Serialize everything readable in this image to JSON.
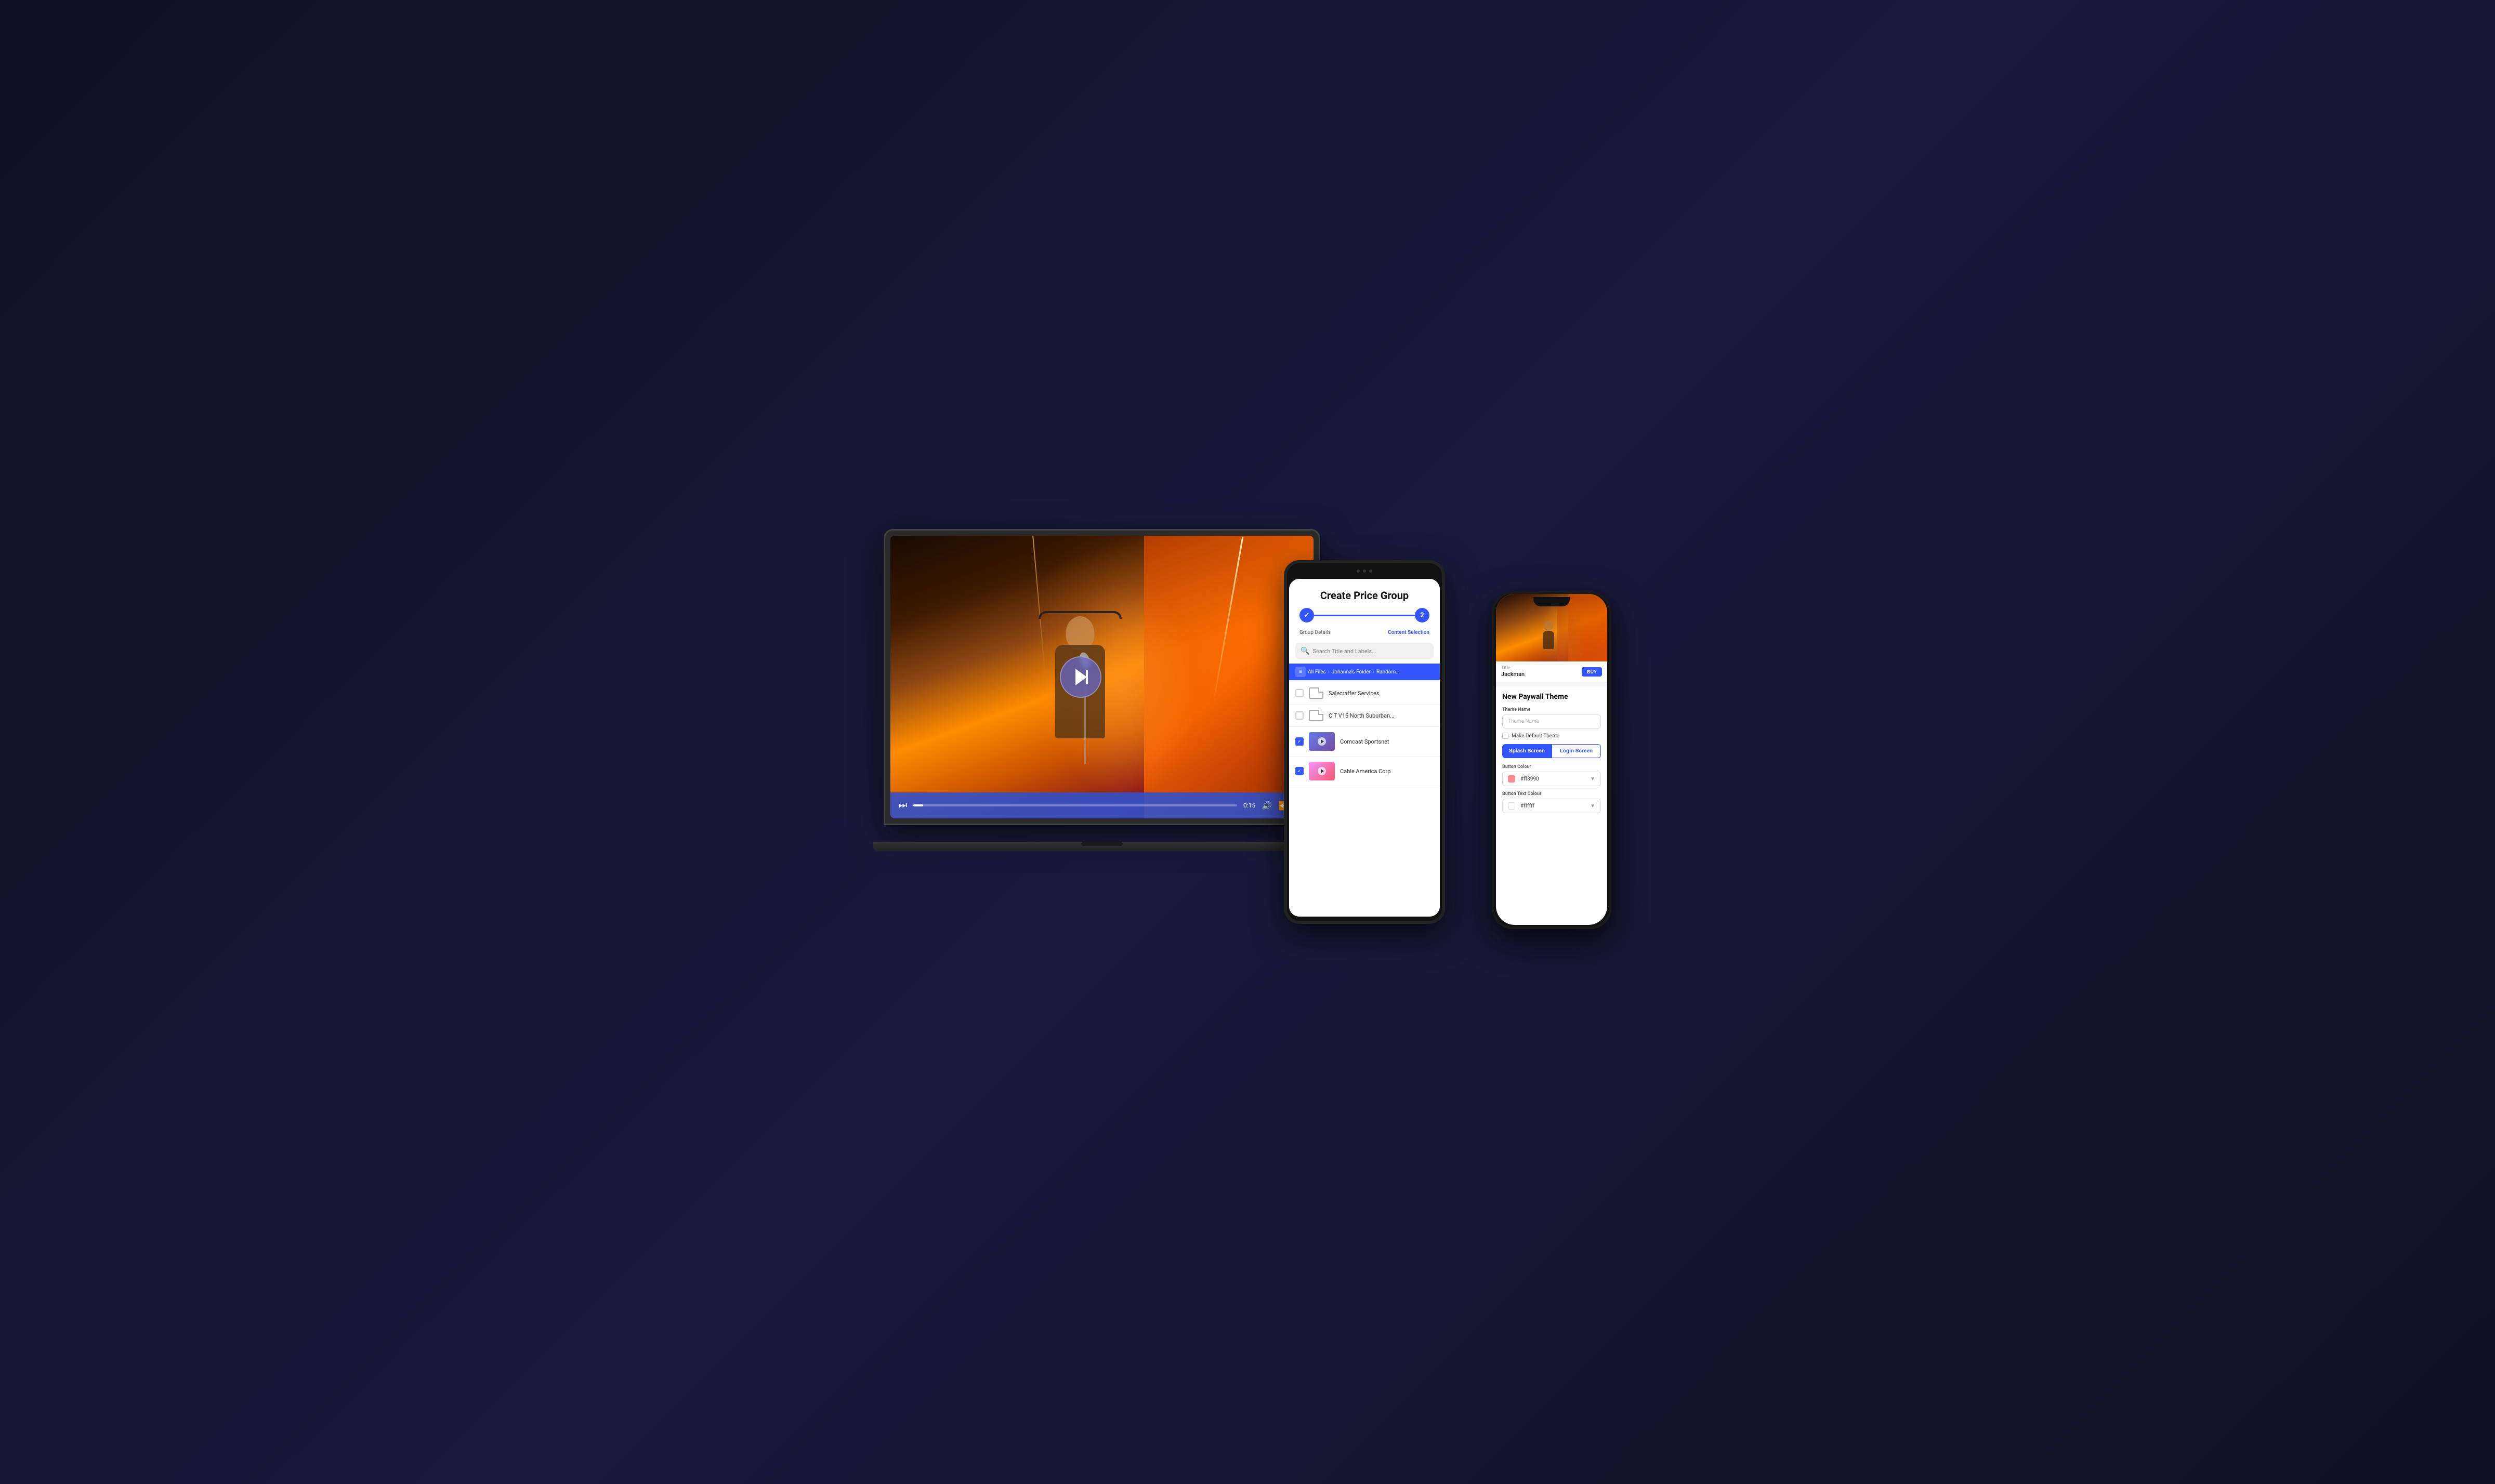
{
  "laptop": {
    "video": {
      "progress_percent": 3,
      "time_current": "0:15",
      "play_button_label": "play-skip-forward"
    },
    "controls": {
      "play_label": "⏭",
      "volume_label": "🔊",
      "rewind_label": "⏪"
    }
  },
  "tablet": {
    "title": "Create Price Group",
    "stepper": {
      "step1_label": "Group Details",
      "step2_label": "Content Selection",
      "step1_done": true,
      "step2_active": true
    },
    "search_placeholder": "Search Title and Labels...",
    "breadcrumb": {
      "items": [
        "All Files",
        "Johanna's Folder",
        "Random..."
      ]
    },
    "files": [
      {
        "type": "folder",
        "name": "Salecraffer Services",
        "checked": false
      },
      {
        "type": "folder",
        "name": "C T V15 North Suburban...",
        "checked": false
      },
      {
        "type": "video",
        "name": "Comcast Sportsnet",
        "checked": true,
        "thumb": "purple"
      },
      {
        "type": "video",
        "name": "Cable America Corp",
        "checked": true,
        "thumb": "pink"
      }
    ]
  },
  "phone": {
    "hero": {
      "alt": "Concert performance"
    },
    "card": {
      "title_label": "Title",
      "name": "Jackman",
      "buy_label": "BUY"
    },
    "paywall_section": {
      "title": "New Paywall Theme",
      "theme_name_label": "Theme Name",
      "theme_name_placeholder": "Theme Name",
      "make_default_label": "Make Default Theme",
      "tab_splash": "Splash Screen",
      "tab_login": "Login Screen",
      "button_colour_label": "Button Colour",
      "button_colour_value": "#ff8990",
      "button_text_colour_label": "Button Text Colour",
      "button_text_colour_value": "#ffffff"
    }
  }
}
